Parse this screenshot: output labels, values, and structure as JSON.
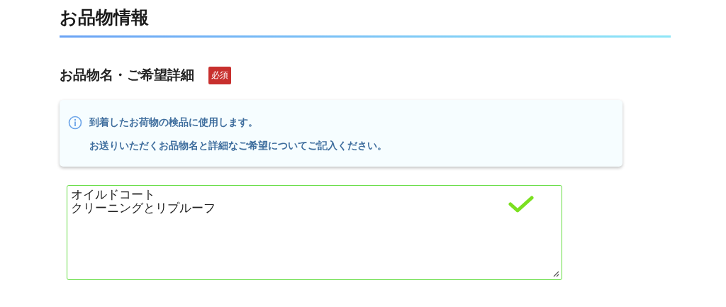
{
  "section": {
    "title": "お品物情報"
  },
  "field": {
    "label": "お品物名・ご希望詳細",
    "badge": "必須",
    "info_lines": [
      "到着したお荷物の検品に使用します。",
      "お送りいただくお品物名と詳細なご希望についてご記入ください。"
    ],
    "value_lines": [
      "オイルドコート",
      "クリーニングとリプルーフ"
    ],
    "valid": true
  }
}
